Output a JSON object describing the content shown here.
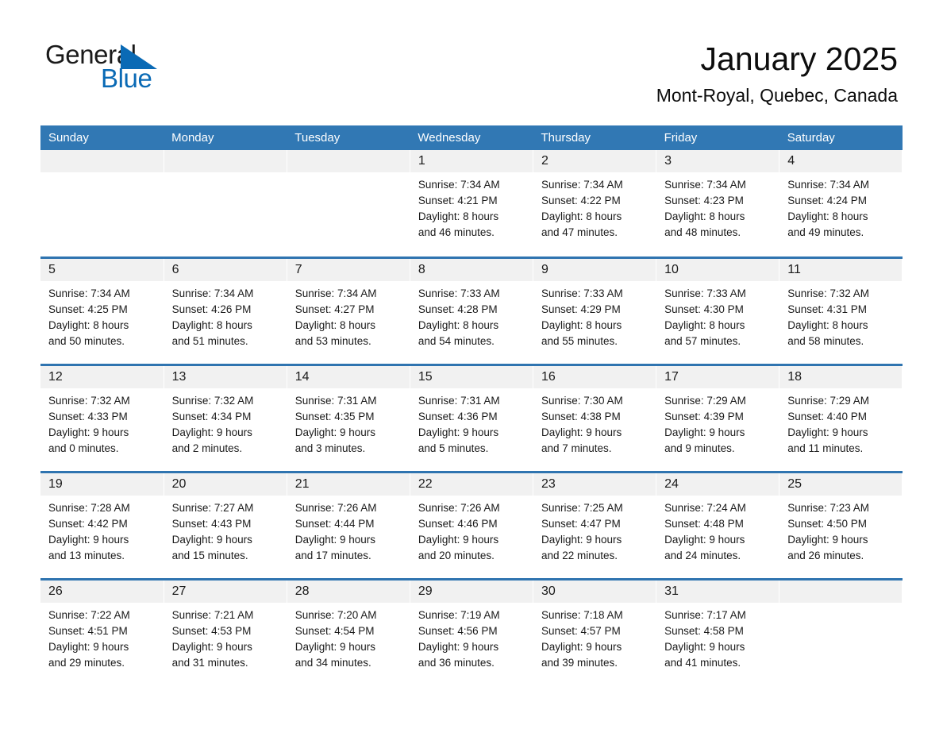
{
  "brand": {
    "name_part1": "General",
    "name_part2": "Blue",
    "triangle_color": "#0a6ab5",
    "accent_color": "#3178b4"
  },
  "header": {
    "title": "January 2025",
    "location": "Mont-Royal, Quebec, Canada"
  },
  "calendar": {
    "weekday_headers": [
      "Sunday",
      "Monday",
      "Tuesday",
      "Wednesday",
      "Thursday",
      "Friday",
      "Saturday"
    ],
    "weeks": [
      [
        {
          "day": "",
          "sunrise": "",
          "sunset": "",
          "daylight_line1": "",
          "daylight_line2": "",
          "empty": true
        },
        {
          "day": "",
          "sunrise": "",
          "sunset": "",
          "daylight_line1": "",
          "daylight_line2": "",
          "empty": true
        },
        {
          "day": "",
          "sunrise": "",
          "sunset": "",
          "daylight_line1": "",
          "daylight_line2": "",
          "empty": true
        },
        {
          "day": "1",
          "sunrise": "Sunrise: 7:34 AM",
          "sunset": "Sunset: 4:21 PM",
          "daylight_line1": "Daylight: 8 hours",
          "daylight_line2": "and 46 minutes.",
          "empty": false
        },
        {
          "day": "2",
          "sunrise": "Sunrise: 7:34 AM",
          "sunset": "Sunset: 4:22 PM",
          "daylight_line1": "Daylight: 8 hours",
          "daylight_line2": "and 47 minutes.",
          "empty": false
        },
        {
          "day": "3",
          "sunrise": "Sunrise: 7:34 AM",
          "sunset": "Sunset: 4:23 PM",
          "daylight_line1": "Daylight: 8 hours",
          "daylight_line2": "and 48 minutes.",
          "empty": false
        },
        {
          "day": "4",
          "sunrise": "Sunrise: 7:34 AM",
          "sunset": "Sunset: 4:24 PM",
          "daylight_line1": "Daylight: 8 hours",
          "daylight_line2": "and 49 minutes.",
          "empty": false
        }
      ],
      [
        {
          "day": "5",
          "sunrise": "Sunrise: 7:34 AM",
          "sunset": "Sunset: 4:25 PM",
          "daylight_line1": "Daylight: 8 hours",
          "daylight_line2": "and 50 minutes.",
          "empty": false
        },
        {
          "day": "6",
          "sunrise": "Sunrise: 7:34 AM",
          "sunset": "Sunset: 4:26 PM",
          "daylight_line1": "Daylight: 8 hours",
          "daylight_line2": "and 51 minutes.",
          "empty": false
        },
        {
          "day": "7",
          "sunrise": "Sunrise: 7:34 AM",
          "sunset": "Sunset: 4:27 PM",
          "daylight_line1": "Daylight: 8 hours",
          "daylight_line2": "and 53 minutes.",
          "empty": false
        },
        {
          "day": "8",
          "sunrise": "Sunrise: 7:33 AM",
          "sunset": "Sunset: 4:28 PM",
          "daylight_line1": "Daylight: 8 hours",
          "daylight_line2": "and 54 minutes.",
          "empty": false
        },
        {
          "day": "9",
          "sunrise": "Sunrise: 7:33 AM",
          "sunset": "Sunset: 4:29 PM",
          "daylight_line1": "Daylight: 8 hours",
          "daylight_line2": "and 55 minutes.",
          "empty": false
        },
        {
          "day": "10",
          "sunrise": "Sunrise: 7:33 AM",
          "sunset": "Sunset: 4:30 PM",
          "daylight_line1": "Daylight: 8 hours",
          "daylight_line2": "and 57 minutes.",
          "empty": false
        },
        {
          "day": "11",
          "sunrise": "Sunrise: 7:32 AM",
          "sunset": "Sunset: 4:31 PM",
          "daylight_line1": "Daylight: 8 hours",
          "daylight_line2": "and 58 minutes.",
          "empty": false
        }
      ],
      [
        {
          "day": "12",
          "sunrise": "Sunrise: 7:32 AM",
          "sunset": "Sunset: 4:33 PM",
          "daylight_line1": "Daylight: 9 hours",
          "daylight_line2": "and 0 minutes.",
          "empty": false
        },
        {
          "day": "13",
          "sunrise": "Sunrise: 7:32 AM",
          "sunset": "Sunset: 4:34 PM",
          "daylight_line1": "Daylight: 9 hours",
          "daylight_line2": "and 2 minutes.",
          "empty": false
        },
        {
          "day": "14",
          "sunrise": "Sunrise: 7:31 AM",
          "sunset": "Sunset: 4:35 PM",
          "daylight_line1": "Daylight: 9 hours",
          "daylight_line2": "and 3 minutes.",
          "empty": false
        },
        {
          "day": "15",
          "sunrise": "Sunrise: 7:31 AM",
          "sunset": "Sunset: 4:36 PM",
          "daylight_line1": "Daylight: 9 hours",
          "daylight_line2": "and 5 minutes.",
          "empty": false
        },
        {
          "day": "16",
          "sunrise": "Sunrise: 7:30 AM",
          "sunset": "Sunset: 4:38 PM",
          "daylight_line1": "Daylight: 9 hours",
          "daylight_line2": "and 7 minutes.",
          "empty": false
        },
        {
          "day": "17",
          "sunrise": "Sunrise: 7:29 AM",
          "sunset": "Sunset: 4:39 PM",
          "daylight_line1": "Daylight: 9 hours",
          "daylight_line2": "and 9 minutes.",
          "empty": false
        },
        {
          "day": "18",
          "sunrise": "Sunrise: 7:29 AM",
          "sunset": "Sunset: 4:40 PM",
          "daylight_line1": "Daylight: 9 hours",
          "daylight_line2": "and 11 minutes.",
          "empty": false
        }
      ],
      [
        {
          "day": "19",
          "sunrise": "Sunrise: 7:28 AM",
          "sunset": "Sunset: 4:42 PM",
          "daylight_line1": "Daylight: 9 hours",
          "daylight_line2": "and 13 minutes.",
          "empty": false
        },
        {
          "day": "20",
          "sunrise": "Sunrise: 7:27 AM",
          "sunset": "Sunset: 4:43 PM",
          "daylight_line1": "Daylight: 9 hours",
          "daylight_line2": "and 15 minutes.",
          "empty": false
        },
        {
          "day": "21",
          "sunrise": "Sunrise: 7:26 AM",
          "sunset": "Sunset: 4:44 PM",
          "daylight_line1": "Daylight: 9 hours",
          "daylight_line2": "and 17 minutes.",
          "empty": false
        },
        {
          "day": "22",
          "sunrise": "Sunrise: 7:26 AM",
          "sunset": "Sunset: 4:46 PM",
          "daylight_line1": "Daylight: 9 hours",
          "daylight_line2": "and 20 minutes.",
          "empty": false
        },
        {
          "day": "23",
          "sunrise": "Sunrise: 7:25 AM",
          "sunset": "Sunset: 4:47 PM",
          "daylight_line1": "Daylight: 9 hours",
          "daylight_line2": "and 22 minutes.",
          "empty": false
        },
        {
          "day": "24",
          "sunrise": "Sunrise: 7:24 AM",
          "sunset": "Sunset: 4:48 PM",
          "daylight_line1": "Daylight: 9 hours",
          "daylight_line2": "and 24 minutes.",
          "empty": false
        },
        {
          "day": "25",
          "sunrise": "Sunrise: 7:23 AM",
          "sunset": "Sunset: 4:50 PM",
          "daylight_line1": "Daylight: 9 hours",
          "daylight_line2": "and 26 minutes.",
          "empty": false
        }
      ],
      [
        {
          "day": "26",
          "sunrise": "Sunrise: 7:22 AM",
          "sunset": "Sunset: 4:51 PM",
          "daylight_line1": "Daylight: 9 hours",
          "daylight_line2": "and 29 minutes.",
          "empty": false
        },
        {
          "day": "27",
          "sunrise": "Sunrise: 7:21 AM",
          "sunset": "Sunset: 4:53 PM",
          "daylight_line1": "Daylight: 9 hours",
          "daylight_line2": "and 31 minutes.",
          "empty": false
        },
        {
          "day": "28",
          "sunrise": "Sunrise: 7:20 AM",
          "sunset": "Sunset: 4:54 PM",
          "daylight_line1": "Daylight: 9 hours",
          "daylight_line2": "and 34 minutes.",
          "empty": false
        },
        {
          "day": "29",
          "sunrise": "Sunrise: 7:19 AM",
          "sunset": "Sunset: 4:56 PM",
          "daylight_line1": "Daylight: 9 hours",
          "daylight_line2": "and 36 minutes.",
          "empty": false
        },
        {
          "day": "30",
          "sunrise": "Sunrise: 7:18 AM",
          "sunset": "Sunset: 4:57 PM",
          "daylight_line1": "Daylight: 9 hours",
          "daylight_line2": "and 39 minutes.",
          "empty": false
        },
        {
          "day": "31",
          "sunrise": "Sunrise: 7:17 AM",
          "sunset": "Sunset: 4:58 PM",
          "daylight_line1": "Daylight: 9 hours",
          "daylight_line2": "and 41 minutes.",
          "empty": false
        },
        {
          "day": "",
          "sunrise": "",
          "sunset": "",
          "daylight_line1": "",
          "daylight_line2": "",
          "empty": true
        }
      ]
    ]
  }
}
